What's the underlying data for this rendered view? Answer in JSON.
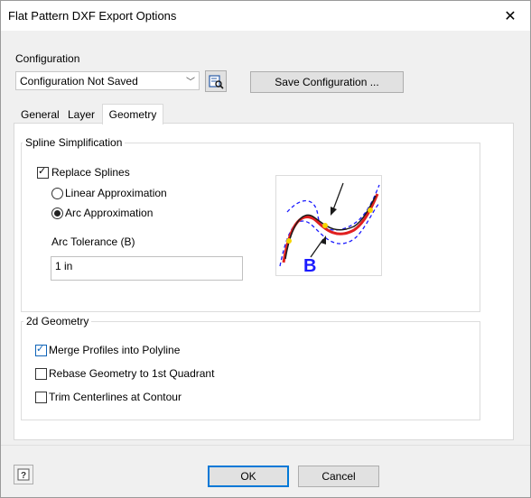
{
  "window": {
    "title": "Flat Pattern DXF Export Options",
    "close_glyph": "✕"
  },
  "configuration": {
    "label": "Configuration",
    "selected": "Configuration Not Saved",
    "dropdown_arrow": "﹀",
    "save_button": "Save Configuration ..."
  },
  "tabs": [
    {
      "label": "General",
      "active": false
    },
    {
      "label": "Layer",
      "active": false
    },
    {
      "label": "Geometry",
      "active": true
    }
  ],
  "spline": {
    "group_label": "Spline Simplification",
    "replace_label": "Replace Splines",
    "replace_checked": true,
    "linear_label": "Linear Approximation",
    "linear_selected": false,
    "arc_label": "Arc Approximation",
    "arc_selected": true,
    "tolerance_label": "Arc Tolerance (B)",
    "tolerance_value": "1 in",
    "diagram_label": "B"
  },
  "geometry2d": {
    "group_label": "2d Geometry",
    "options": [
      {
        "label": "Merge Profiles into Polyline",
        "checked": true
      },
      {
        "label": "Rebase Geometry to 1st Quadrant",
        "checked": false
      },
      {
        "label": "Trim Centerlines at Contour",
        "checked": false
      }
    ]
  },
  "footer": {
    "ok": "OK",
    "cancel": "Cancel",
    "help_icon": "help-icon"
  },
  "colors": {
    "accent": "#0078d7",
    "diagram_blue": "#1a1aff",
    "diagram_red": "#e02020",
    "diagram_yellow": "#f5d400"
  },
  "check_glyph": "✓"
}
